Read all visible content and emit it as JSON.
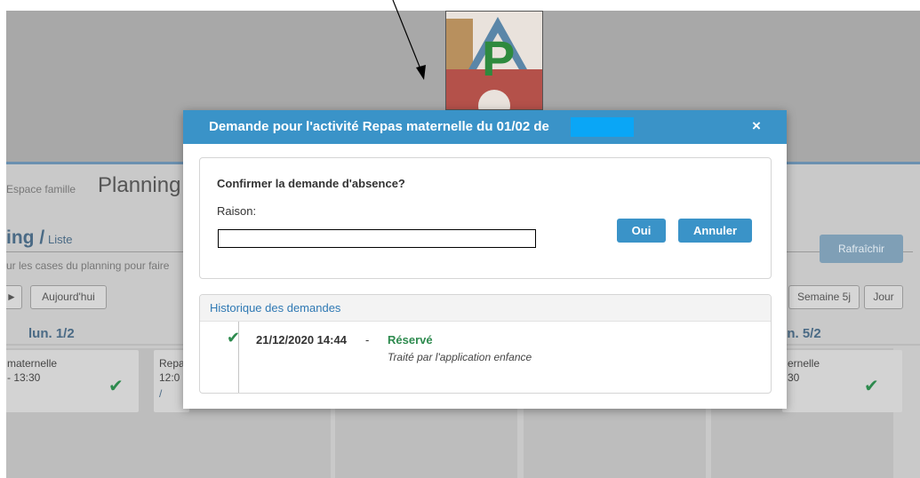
{
  "modal": {
    "title": "Demande pour l'activité Repas maternelle du 01/02 de",
    "close_symbol": "×",
    "question": "Confirmer la demande d'absence?",
    "reason_label": "Raison:",
    "reason_value": "",
    "yes_label": "Oui",
    "cancel_label": "Annuler",
    "history": {
      "title": "Historique des demandes",
      "entries": [
        {
          "datetime": "21/12/2020 14:44",
          "separator": "-",
          "status": "Réservé",
          "detail": "Traité par l'application enfance"
        }
      ]
    }
  },
  "background": {
    "breadcrumb_home": "Espace famille",
    "page_title": "Planning",
    "subtitle_main": "ing /",
    "subtitle_sub": "Liste",
    "hint": "ur les cases du planning pour faire",
    "prev_label": "►",
    "today_label": "Aujourd'hui",
    "refresh_label": "Rafraîchir",
    "week5_label": "Semaine 5j",
    "day_label": "Jour",
    "day_mon": "lun. 1/2",
    "day_fri": "en. 5/2",
    "cards": [
      {
        "line1": "maternelle",
        "line2": "- 13:30",
        "line3": ""
      },
      {
        "line1": "Repa",
        "line2": "12:0",
        "line3": "/"
      },
      {
        "line1": "ernelle",
        "line2": "30",
        "line3": ""
      }
    ]
  },
  "colors": {
    "modal_header": "#3a93c8",
    "status_green": "#2d8a4e",
    "link_blue": "#2f79b4"
  },
  "icons": [
    "close-icon",
    "check-icon",
    "logo-image"
  ]
}
